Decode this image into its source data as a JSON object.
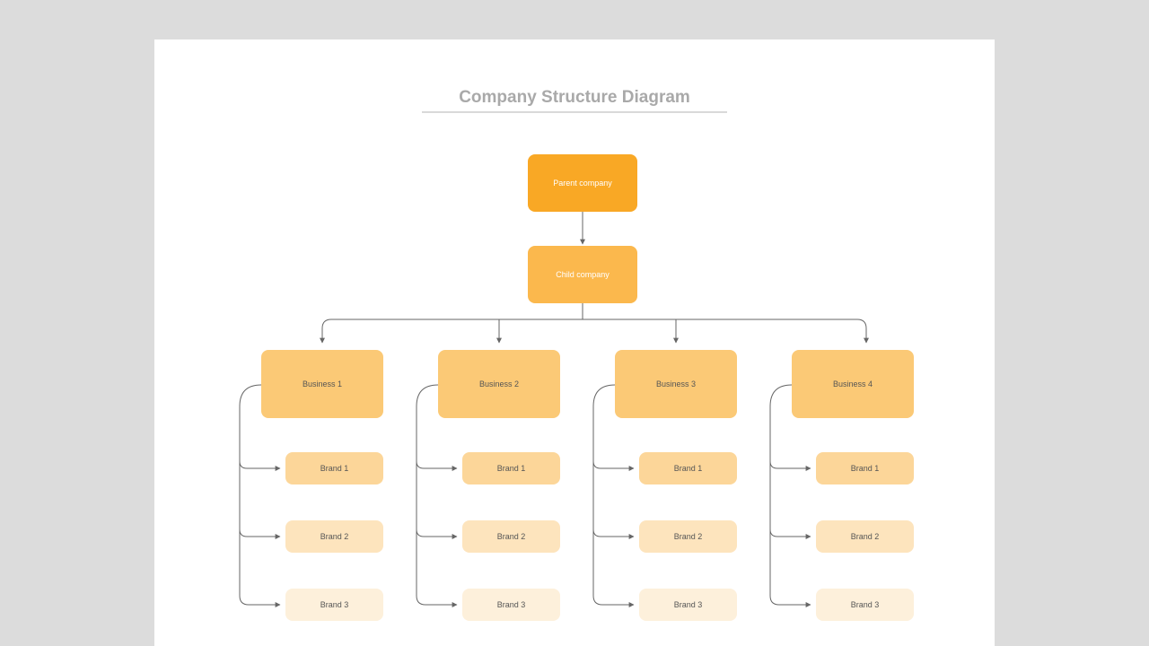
{
  "title": "Company Structure Diagram",
  "parent": "Parent company",
  "child": "Child company",
  "businesses": [
    {
      "name": "Business 1",
      "brands": [
        "Brand 1",
        "Brand 2",
        "Brand 3"
      ]
    },
    {
      "name": "Business 2",
      "brands": [
        "Brand 1",
        "Brand 2",
        "Brand 3"
      ]
    },
    {
      "name": "Business 3",
      "brands": [
        "Brand 1",
        "Brand 2",
        "Brand 3"
      ]
    },
    {
      "name": "Business 4",
      "brands": [
        "Brand 1",
        "Brand 2",
        "Brand 3"
      ]
    }
  ]
}
